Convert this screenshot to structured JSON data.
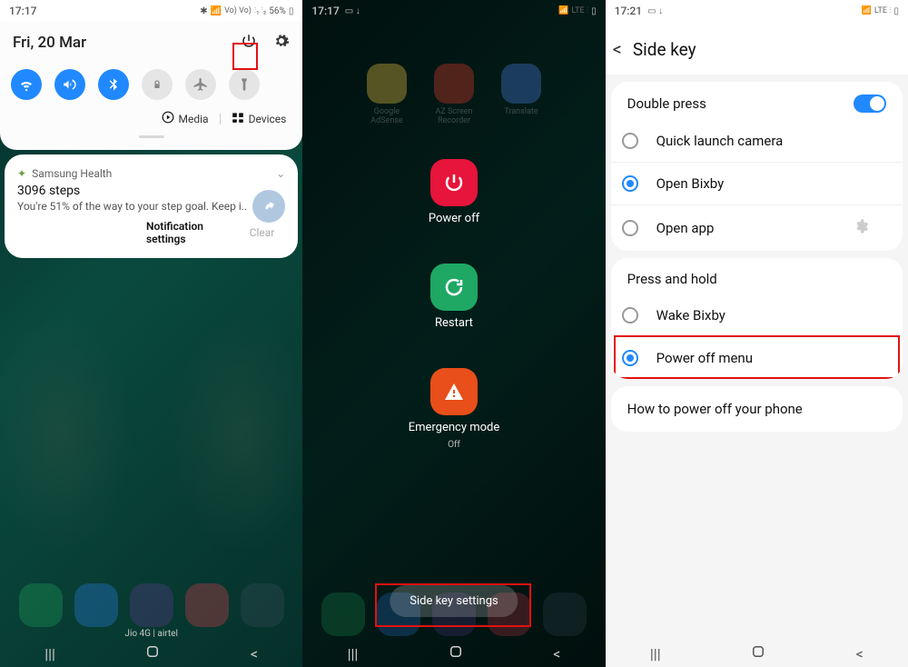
{
  "screen1": {
    "status": {
      "time": "17:17",
      "battery_pct": "56%",
      "carriers_mini": "LTE1 LTE2"
    },
    "date": "Fri, 20 Mar",
    "qs": [
      "wifi",
      "sound",
      "bluetooth",
      "lock",
      "airplane",
      "flashlight"
    ],
    "media": "Media",
    "devices": "Devices",
    "notif": {
      "app": "Samsung Health",
      "title": "3096 steps",
      "body": "You're 51% of the way to your step goal. Keep i.."
    },
    "notif_settings": "Notification settings",
    "clear": "Clear",
    "carrier": "Jio 4G | airtel"
  },
  "screen2": {
    "status": {
      "time": "17:17"
    },
    "top_apps": [
      {
        "label": "Google AdSense",
        "color": "#f5c945"
      },
      {
        "label": "AZ Screen Recorder",
        "color": "#e43a2a"
      },
      {
        "label": "Translate",
        "color": "#4a7fe0"
      }
    ],
    "power_off": "Power off",
    "restart": "Restart",
    "emergency": "Emergency mode",
    "emergency_sub": "Off",
    "side_key_btn": "Side key settings"
  },
  "screen3": {
    "status": {
      "time": "17:21"
    },
    "title": "Side key",
    "double_press": "Double press",
    "options1": [
      "Quick launch camera",
      "Open Bixby",
      "Open app"
    ],
    "press_hold": "Press and hold",
    "options2": [
      "Wake Bixby",
      "Power off menu"
    ],
    "howto": "How to power off your phone",
    "selected1_index": 1,
    "selected2_index": 1
  }
}
